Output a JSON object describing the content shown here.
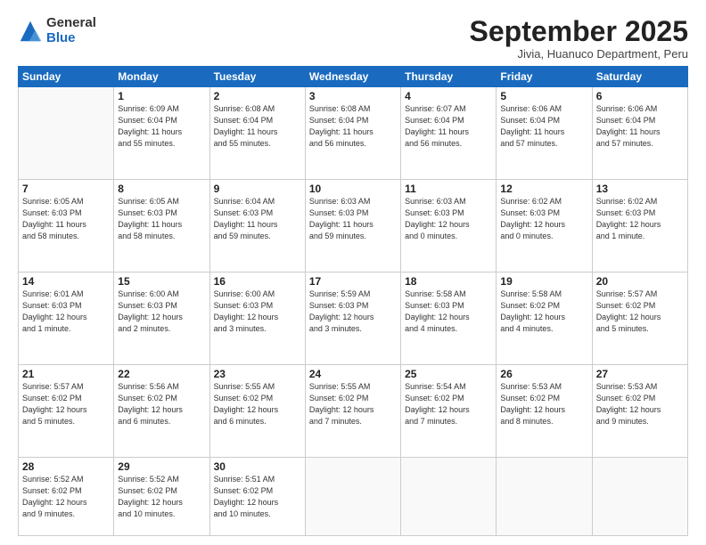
{
  "logo": {
    "general": "General",
    "blue": "Blue"
  },
  "header": {
    "month": "September 2025",
    "location": "Jivia, Huanuco Department, Peru"
  },
  "weekdays": [
    "Sunday",
    "Monday",
    "Tuesday",
    "Wednesday",
    "Thursday",
    "Friday",
    "Saturday"
  ],
  "weeks": [
    [
      {
        "day": "",
        "info": ""
      },
      {
        "day": "1",
        "info": "Sunrise: 6:09 AM\nSunset: 6:04 PM\nDaylight: 11 hours\nand 55 minutes."
      },
      {
        "day": "2",
        "info": "Sunrise: 6:08 AM\nSunset: 6:04 PM\nDaylight: 11 hours\nand 55 minutes."
      },
      {
        "day": "3",
        "info": "Sunrise: 6:08 AM\nSunset: 6:04 PM\nDaylight: 11 hours\nand 56 minutes."
      },
      {
        "day": "4",
        "info": "Sunrise: 6:07 AM\nSunset: 6:04 PM\nDaylight: 11 hours\nand 56 minutes."
      },
      {
        "day": "5",
        "info": "Sunrise: 6:06 AM\nSunset: 6:04 PM\nDaylight: 11 hours\nand 57 minutes."
      },
      {
        "day": "6",
        "info": "Sunrise: 6:06 AM\nSunset: 6:04 PM\nDaylight: 11 hours\nand 57 minutes."
      }
    ],
    [
      {
        "day": "7",
        "info": "Sunrise: 6:05 AM\nSunset: 6:03 PM\nDaylight: 11 hours\nand 58 minutes."
      },
      {
        "day": "8",
        "info": "Sunrise: 6:05 AM\nSunset: 6:03 PM\nDaylight: 11 hours\nand 58 minutes."
      },
      {
        "day": "9",
        "info": "Sunrise: 6:04 AM\nSunset: 6:03 PM\nDaylight: 11 hours\nand 59 minutes."
      },
      {
        "day": "10",
        "info": "Sunrise: 6:03 AM\nSunset: 6:03 PM\nDaylight: 11 hours\nand 59 minutes."
      },
      {
        "day": "11",
        "info": "Sunrise: 6:03 AM\nSunset: 6:03 PM\nDaylight: 12 hours\nand 0 minutes."
      },
      {
        "day": "12",
        "info": "Sunrise: 6:02 AM\nSunset: 6:03 PM\nDaylight: 12 hours\nand 0 minutes."
      },
      {
        "day": "13",
        "info": "Sunrise: 6:02 AM\nSunset: 6:03 PM\nDaylight: 12 hours\nand 1 minute."
      }
    ],
    [
      {
        "day": "14",
        "info": "Sunrise: 6:01 AM\nSunset: 6:03 PM\nDaylight: 12 hours\nand 1 minute."
      },
      {
        "day": "15",
        "info": "Sunrise: 6:00 AM\nSunset: 6:03 PM\nDaylight: 12 hours\nand 2 minutes."
      },
      {
        "day": "16",
        "info": "Sunrise: 6:00 AM\nSunset: 6:03 PM\nDaylight: 12 hours\nand 3 minutes."
      },
      {
        "day": "17",
        "info": "Sunrise: 5:59 AM\nSunset: 6:03 PM\nDaylight: 12 hours\nand 3 minutes."
      },
      {
        "day": "18",
        "info": "Sunrise: 5:58 AM\nSunset: 6:03 PM\nDaylight: 12 hours\nand 4 minutes."
      },
      {
        "day": "19",
        "info": "Sunrise: 5:58 AM\nSunset: 6:02 PM\nDaylight: 12 hours\nand 4 minutes."
      },
      {
        "day": "20",
        "info": "Sunrise: 5:57 AM\nSunset: 6:02 PM\nDaylight: 12 hours\nand 5 minutes."
      }
    ],
    [
      {
        "day": "21",
        "info": "Sunrise: 5:57 AM\nSunset: 6:02 PM\nDaylight: 12 hours\nand 5 minutes."
      },
      {
        "day": "22",
        "info": "Sunrise: 5:56 AM\nSunset: 6:02 PM\nDaylight: 12 hours\nand 6 minutes."
      },
      {
        "day": "23",
        "info": "Sunrise: 5:55 AM\nSunset: 6:02 PM\nDaylight: 12 hours\nand 6 minutes."
      },
      {
        "day": "24",
        "info": "Sunrise: 5:55 AM\nSunset: 6:02 PM\nDaylight: 12 hours\nand 7 minutes."
      },
      {
        "day": "25",
        "info": "Sunrise: 5:54 AM\nSunset: 6:02 PM\nDaylight: 12 hours\nand 7 minutes."
      },
      {
        "day": "26",
        "info": "Sunrise: 5:53 AM\nSunset: 6:02 PM\nDaylight: 12 hours\nand 8 minutes."
      },
      {
        "day": "27",
        "info": "Sunrise: 5:53 AM\nSunset: 6:02 PM\nDaylight: 12 hours\nand 9 minutes."
      }
    ],
    [
      {
        "day": "28",
        "info": "Sunrise: 5:52 AM\nSunset: 6:02 PM\nDaylight: 12 hours\nand 9 minutes."
      },
      {
        "day": "29",
        "info": "Sunrise: 5:52 AM\nSunset: 6:02 PM\nDaylight: 12 hours\nand 10 minutes."
      },
      {
        "day": "30",
        "info": "Sunrise: 5:51 AM\nSunset: 6:02 PM\nDaylight: 12 hours\nand 10 minutes."
      },
      {
        "day": "",
        "info": ""
      },
      {
        "day": "",
        "info": ""
      },
      {
        "day": "",
        "info": ""
      },
      {
        "day": "",
        "info": ""
      }
    ]
  ]
}
